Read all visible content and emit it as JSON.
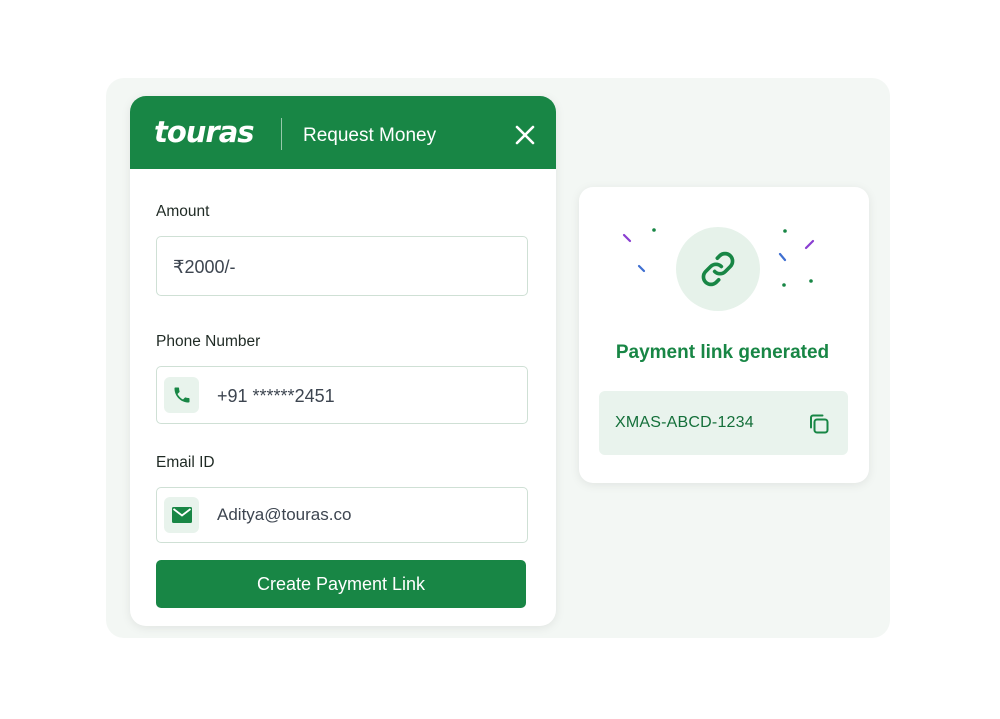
{
  "request_card": {
    "logo": "touras",
    "title": "Request Money",
    "close_icon": "close-icon",
    "fields": {
      "amount": {
        "label": "Amount",
        "value": "₹2000/-"
      },
      "phone": {
        "label": "Phone Number",
        "value": "+91 ******2451",
        "icon": "phone-icon"
      },
      "email": {
        "label": "Email ID",
        "value": "Aditya@touras.co",
        "icon": "mail-icon"
      }
    },
    "submit_label": "Create Payment Link"
  },
  "result_card": {
    "icon": "link-icon",
    "heading": "Payment link generated",
    "code": "XMAS-ABCD-1234",
    "copy_icon": "copy-icon"
  },
  "colors": {
    "brand_green": "#188645",
    "light_green": "#e8f3ec",
    "backdrop": "#f3f7f4"
  }
}
